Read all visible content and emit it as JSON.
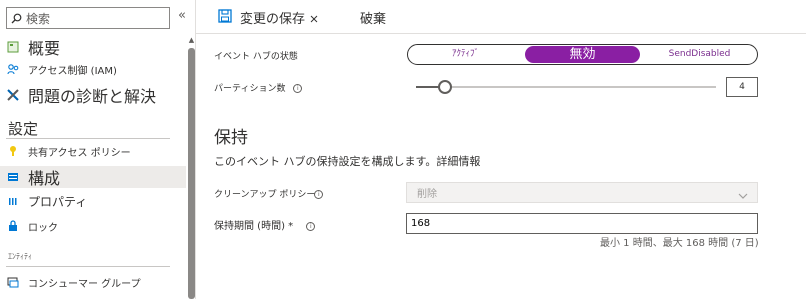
{
  "sidebar": {
    "search_placeholder": "検索",
    "collapse": "«",
    "items": [
      {
        "label": "概要",
        "icon": "overview-icon"
      },
      {
        "label": "アクセス制御 (IAM)",
        "icon": "iam-icon"
      },
      {
        "label": "問題の診断と解決",
        "icon": "wrench-icon"
      }
    ],
    "settings_header": "設定",
    "settings_items": [
      {
        "label": "共有アクセス ポリシー",
        "icon": "key-icon"
      },
      {
        "label": "構成",
        "icon": "config-icon"
      },
      {
        "label": "プロパティ",
        "icon": "properties-icon"
      },
      {
        "label": "ロック",
        "icon": "lock-icon"
      }
    ],
    "entity_header": "ｴﾝﾃｨﾃｨ",
    "entity_items": [
      {
        "label": "コンシューマー グループ",
        "icon": "consumer-group-icon"
      }
    ]
  },
  "toolbar": {
    "save_label": "変更の保存",
    "discard_label": "破棄"
  },
  "form": {
    "status_label": "イベント ハブの状態",
    "status_options": [
      "ｱｸﾃｨﾌﾞ",
      "無効",
      "SendDisabled"
    ],
    "status_selected": "無効",
    "partition_label": "パーティション数",
    "partition_value": "4",
    "retention_title": "保持",
    "retention_desc": "このイベント ハブの保持設定を構成します。詳細情報",
    "cleanup_label": "クリーンアップ ポリシー",
    "cleanup_value": "削除",
    "period_label": "保持期間 (時間) *",
    "period_value": "168",
    "period_hint": "最小 1 時間、最大 168 時間 (7 日)"
  },
  "colors": {
    "accent": "#8a1fa3",
    "save_icon": "#0078d4"
  }
}
